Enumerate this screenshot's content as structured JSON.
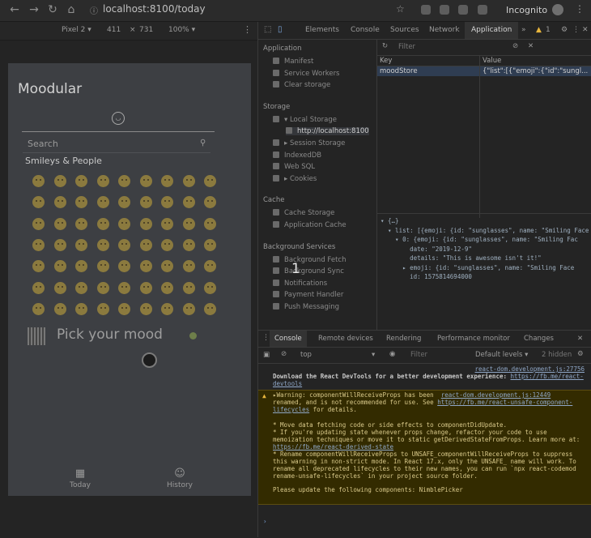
{
  "browser": {
    "url": "localhost:8100/today",
    "mode_label": "Incognito",
    "nav_icons": [
      "back-icon",
      "forward-icon",
      "reload-icon",
      "home-icon"
    ]
  },
  "device_toolbar": {
    "device": "Pixel 2 ▾",
    "width": "411",
    "x": "×",
    "height": "731",
    "zoom": "100% ▾"
  },
  "app": {
    "title": "Moodular",
    "search_placeholder": "Search",
    "category": "Smileys & People",
    "emoji_rows": 7,
    "emoji_cols": 9,
    "pick_label": "Pick your mood",
    "tabs": [
      {
        "label": "Today",
        "icon": "calendar-icon"
      },
      {
        "label": "History",
        "icon": "smiley-icon"
      }
    ]
  },
  "devtools": {
    "tabs": [
      "Elements",
      "Console",
      "Sources",
      "Network",
      "Application"
    ],
    "more_tabs": "»",
    "error_count": "1",
    "sidebar": [
      {
        "type": "section",
        "label": "Application"
      },
      {
        "type": "item",
        "label": "Manifest"
      },
      {
        "type": "item",
        "label": "Service Workers"
      },
      {
        "type": "item",
        "label": "Clear storage"
      },
      {
        "type": "section",
        "label": "Storage"
      },
      {
        "type": "item",
        "label": "▾ Local Storage"
      },
      {
        "type": "subitem",
        "label": "http://localhost:8100"
      },
      {
        "type": "item",
        "label": "▸ Session Storage"
      },
      {
        "type": "item",
        "label": "IndexedDB"
      },
      {
        "type": "item",
        "label": "Web SQL"
      },
      {
        "type": "item",
        "label": "▸ Cookies"
      },
      {
        "type": "section",
        "label": "Cache"
      },
      {
        "type": "item",
        "label": "Cache Storage"
      },
      {
        "type": "item",
        "label": "Application Cache"
      },
      {
        "type": "section",
        "label": "Background Services"
      },
      {
        "type": "item",
        "label": "Background Fetch"
      },
      {
        "type": "item",
        "label": "Background Sync"
      },
      {
        "type": "item",
        "label": "Notifications"
      },
      {
        "type": "item",
        "label": "Payment Handler"
      },
      {
        "type": "item",
        "label": "Push Messaging"
      }
    ],
    "filter_placeholder": "Filter",
    "table": {
      "key_header": "Key",
      "value_header": "Value",
      "rows": [
        {
          "key": "moodStore",
          "value": "{\"list\":[{\"emoji\":{\"id\":\"sungl..."
        }
      ]
    },
    "preview_lines": [
      "▾ {…}",
      "  ▾ list: [{emoji: {id: \"sunglasses\", name: \"Smiling Face",
      "    ▾ 0: {emoji: {id: \"sunglasses\", name: \"Smiling Fac",
      "        date: \"2019-12-9\"",
      "        details: \"This is awesome isn't it!\"",
      "      ▸ emoji: {id: \"sunglasses\", name: \"Smiling Face",
      "        id: 1575814694000"
    ],
    "drawer_tabs": [
      "Console",
      "Remote devices",
      "Rendering",
      "Performance monitor",
      "Changes"
    ],
    "console_toolbar": {
      "context": "top",
      "filter_placeholder": "Filter",
      "levels": "Default levels ▾",
      "hidden": "2 hidden"
    },
    "console_messages": {
      "src1": "react-dom.development.js:27756",
      "info": "Download the React DevTools for a better development experience: ",
      "info_link": "https://fb.me/react-devtools",
      "warn_prefix": "▸Warning: componentWillReceiveProps has been ",
      "src2": "react-dom.development.js:12449",
      "warn_body": "renamed, and is not recommended for use. See ",
      "warn_link": "https://fb.me/react-unsafe-component-lifecycles",
      "warn_tail": " for details.",
      "bullet1": "* Move data fetching code or side effects to componentDidUpdate.",
      "bullet2": "* If you're updating state whenever props change, refactor your code to use memoization techniques or move it to static getDerivedStateFromProps. Learn more at: ",
      "bullet2_link": "https://fb.me/react-derived-state",
      "bullet3": "* Rename componentWillReceiveProps to UNSAFE_componentWillReceiveProps to suppress this warning in non-strict mode. In React 17.x, only the UNSAFE_ name will work. To rename all deprecated lifecycles to their new names, you can run `npx react-codemod rename-unsafe-lifecycles` in your project source folder.",
      "footer": "Please update the following components: NimblePicker"
    }
  },
  "overlay": {
    "step_number": "1"
  },
  "colors": {
    "phone_bg": "#3d3f43",
    "accent_tab": "#333333",
    "selected_row": "#2f3d52"
  }
}
